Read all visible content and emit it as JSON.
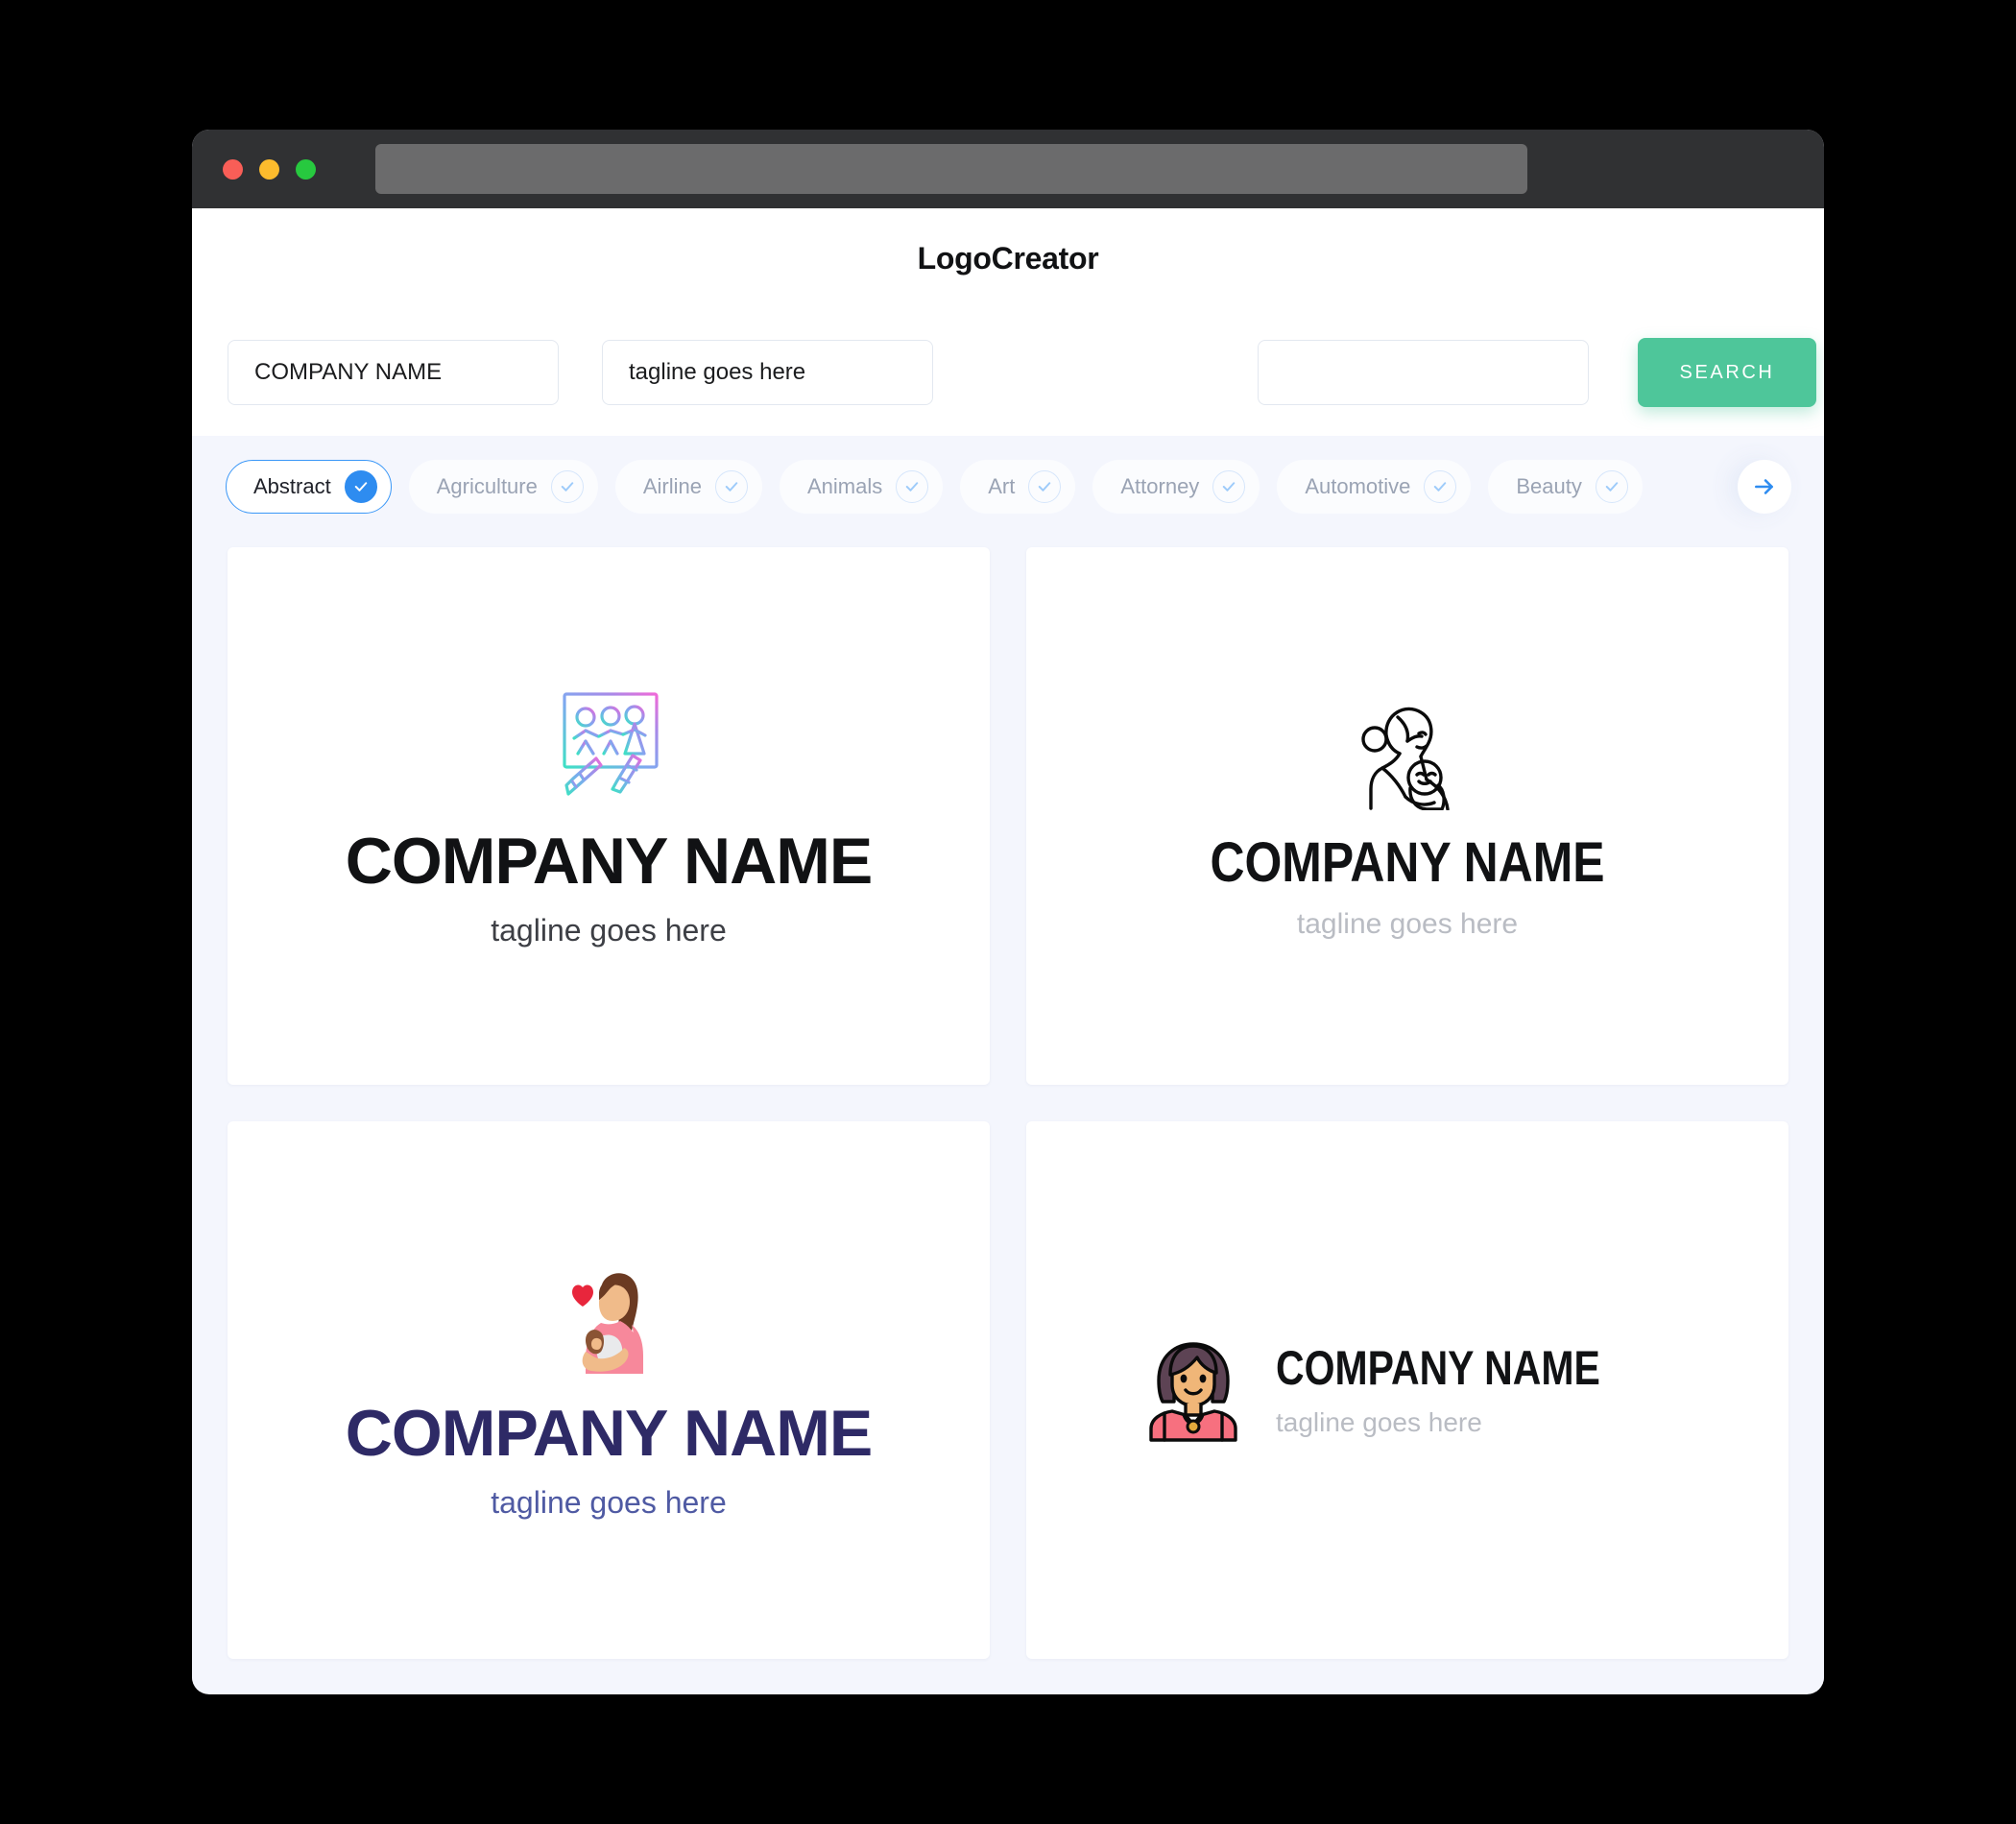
{
  "window": {
    "traffic_lights": [
      "close",
      "minimize",
      "maximize"
    ],
    "url_value": ""
  },
  "header": {
    "brand_title": "LogoCreator"
  },
  "search": {
    "company_value": "COMPANY NAME",
    "company_placeholder": "COMPANY NAME",
    "tagline_value": "tagline goes here",
    "tagline_placeholder": "tagline goes here",
    "keyword_value": "",
    "keyword_placeholder": "",
    "search_button_label": "SEARCH",
    "search_button_color": "#4ec69a"
  },
  "categories": {
    "selected": "Abstract",
    "accent_color": "#2e8cf0",
    "items": [
      {
        "label": "Abstract",
        "selected": true
      },
      {
        "label": "Agriculture",
        "selected": false
      },
      {
        "label": "Airline",
        "selected": false
      },
      {
        "label": "Animals",
        "selected": false
      },
      {
        "label": "Art",
        "selected": false
      },
      {
        "label": "Attorney",
        "selected": false
      },
      {
        "label": "Automotive",
        "selected": false
      },
      {
        "label": "Beauty",
        "selected": false
      }
    ],
    "next_icon": "arrow-right-icon"
  },
  "results": {
    "cards": [
      {
        "icon_name": "children-drawing-gradient-icon",
        "company_name": "COMPANY NAME",
        "tagline": "tagline goes here",
        "name_color": "#111214",
        "tagline_color": "#3d3f45",
        "layout": "stacked"
      },
      {
        "icon_name": "mother-and-baby-lineart-icon",
        "company_name": "COMPANY NAME",
        "tagline": "tagline goes here",
        "name_color": "#111214",
        "tagline_color": "#b9bcc3",
        "layout": "stacked"
      },
      {
        "icon_name": "mother-holding-baby-heart-icon",
        "company_name": "COMPANY NAME",
        "tagline": "tagline goes here",
        "name_color": "#2e2a66",
        "tagline_color": "#4f5aa3",
        "layout": "stacked"
      },
      {
        "icon_name": "woman-avatar-icon",
        "company_name": "COMPANY NAME",
        "tagline": "tagline goes here",
        "name_color": "#111214",
        "tagline_color": "#b9bcc3",
        "layout": "horizontal"
      }
    ]
  }
}
